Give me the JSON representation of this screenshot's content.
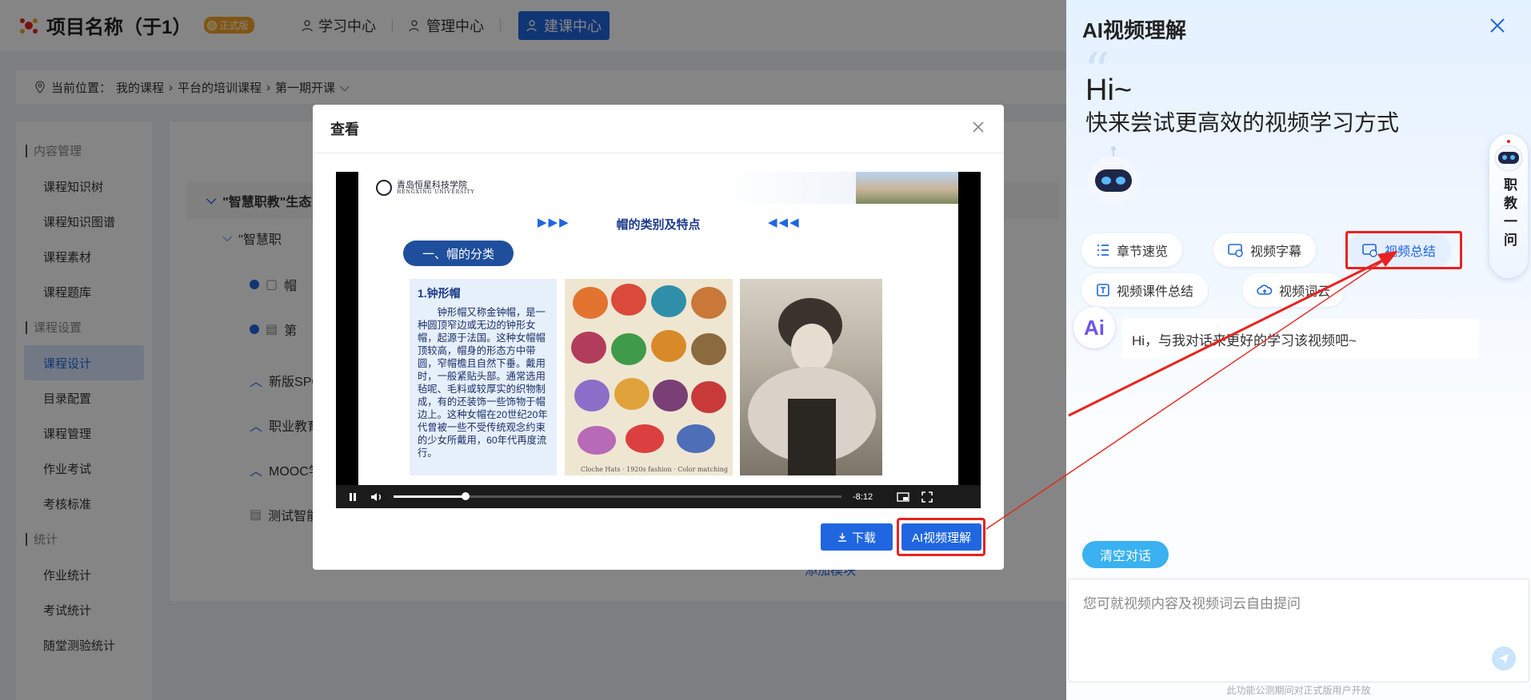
{
  "app": {
    "title": "项目名称（于1）",
    "edition_badge": "正式版",
    "nav": [
      {
        "label": "学习中心"
      },
      {
        "label": "管理中心"
      },
      {
        "label": "建课中心"
      }
    ]
  },
  "breadcrumb": {
    "prefix": "当前位置：",
    "parts": [
      "我的课程",
      "平台的培训课程",
      "第一期开课"
    ]
  },
  "sidebar": {
    "groups": [
      {
        "title": "内容管理",
        "items": [
          "课程知识树",
          "课程知识图谱",
          "课程素材",
          "课程题库"
        ]
      },
      {
        "title": "课程设置",
        "items": [
          "课程设计",
          "目录配置",
          "课程管理",
          "作业考试",
          "考核标准"
        ]
      },
      {
        "title": "统计",
        "items": [
          "作业统计",
          "考试统计",
          "随堂测验统计"
        ]
      }
    ],
    "active_item": "课程设计"
  },
  "content": {
    "tree_rows": [
      "\"智慧职教\"生态",
      "\"智慧职",
      "帽",
      "第",
      "新版SPO",
      "职业教育",
      "MOOC学",
      "测试智能",
      "添加模块"
    ]
  },
  "modal": {
    "title": "查看",
    "download_label": "下载",
    "ai_button_label": "AI视频理解",
    "video": {
      "time_remaining": "-8:12",
      "progress_fraction": 0.16,
      "slide": {
        "school_name": "青岛恒星科技学院",
        "school_name_en": "HENGXING UNIVERSITY",
        "title": "帽的类别及特点",
        "category": "一、帽的分类",
        "section_heading": "1.钟形帽",
        "section_text": "钟形帽又称金钟帽，是一种圆顶窄边或无边的钟形女帽，起源于法国。这种女帽帽顶较高，帽身的形态方中带圆，窄帽檐且自然下垂。戴用时，一般紧贴头部。通常选用毡呢、毛料或较厚实的织物制成，有的还装饰一些饰物于帽边上。这种女帽在20世纪20年代曾被一些不受传统观念约束的少女所戴用，60年代再度流行。",
        "image_caption": "Cloche Hats · 1920s fashion · Color matching"
      }
    }
  },
  "ai_panel": {
    "title": "AI视频理解",
    "greeting": "Hi~",
    "subtitle": "快来尝试更高效的视频学习方式",
    "assistant_label": "职教一问",
    "chips": [
      {
        "label": "章节速览",
        "icon": "list-icon"
      },
      {
        "label": "视频字幕",
        "icon": "caption-icon"
      },
      {
        "label": "视频总结",
        "icon": "summary-icon"
      },
      {
        "label": "视频课件总结",
        "icon": "courseware-icon"
      },
      {
        "label": "视频词云",
        "icon": "cloud-icon"
      }
    ],
    "active_chip": "视频总结",
    "bot_message": "Hi，与我对话来更好的学习该视频吧~",
    "clear_label": "清空对话",
    "input_placeholder": "您可就视频内容及视频词云自由提问",
    "footnote": "此功能公测期间对正式版用户开放",
    "colors": {
      "accent": "#1f66e0",
      "highlight": "#e8231f",
      "clear_button": "#3ab1f0"
    }
  }
}
